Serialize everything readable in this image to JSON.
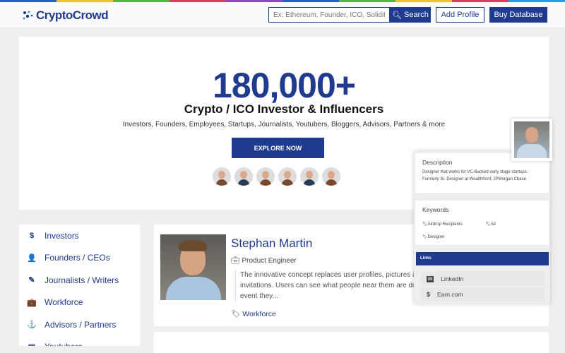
{
  "colors": {
    "brand": "#1f3b8f",
    "stripe": [
      "#2a5bd7",
      "#e8c42a",
      "#5ab44a",
      "#e03a5a",
      "#8a4ab4",
      "#2a5bd7",
      "#5ab44a",
      "#e8c42a",
      "#e03a5a",
      "#2a9bd7"
    ]
  },
  "header": {
    "logo": "CryptoCrowd",
    "search_placeholder": "Ex: Ethereum, Founder, ICO, Solidity etc",
    "search_label": "Search",
    "add_profile": "Add Profile",
    "buy_database": "Buy Database"
  },
  "hero": {
    "count": "180,000+",
    "headline": "Crypto / ICO Investor & Influencers",
    "subline": "Investors, Founders, Employees, Startups, Journalists, Youtubers, Bloggers, Advisors, Partners  & more",
    "cta": "EXPLORE NOW"
  },
  "sidebar": {
    "items": [
      {
        "icon": "dollar-icon",
        "glyph": "$",
        "label": "Investors"
      },
      {
        "icon": "user-tie-icon",
        "glyph": "👤",
        "label": "Founders / CEOs"
      },
      {
        "icon": "pen-icon",
        "glyph": "✎",
        "label": "Journalists / Writers"
      },
      {
        "icon": "briefcase-icon",
        "glyph": "💼",
        "label": "Workforce"
      },
      {
        "icon": "anchor-icon",
        "glyph": "⚓",
        "label": "Advisors / Partners"
      },
      {
        "icon": "list-icon",
        "glyph": "▤",
        "label": "Youtubers"
      }
    ]
  },
  "profile": {
    "name": "Stephan Martin",
    "role": "Product Engineer",
    "description": [
      "The innovative concept replaces user profiles, pictures and",
      "invitations. Users can see what people near them are doing at the",
      "event they..."
    ],
    "tag": "Workforce"
  },
  "popup": {
    "description_title": "Description",
    "description": [
      "Designer that works for VC-Backed early stage startups.",
      "Formerly Sr. Designer at Wealthfront, JPMorgan Chase"
    ],
    "keywords_title": "Keywords",
    "keywords": [
      "Airdrop Recipients",
      "All",
      "Designer"
    ],
    "links_title": "Links",
    "links": [
      "LinkedIn",
      "Earn.com"
    ]
  }
}
